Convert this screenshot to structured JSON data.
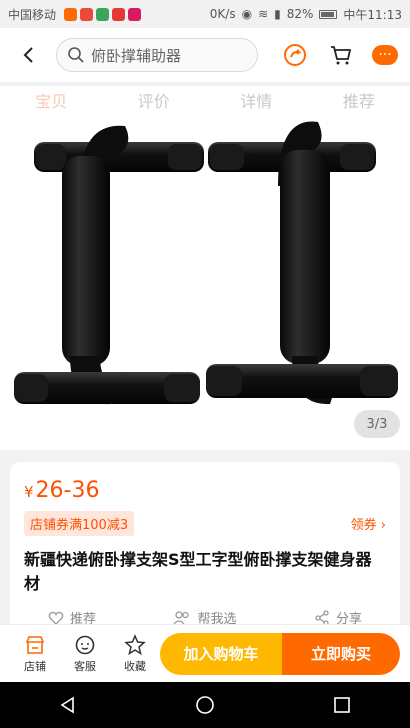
{
  "status_bar": {
    "carrier": "中国移动",
    "speed": "0K/s",
    "battery": "82%",
    "time": "中午11:13"
  },
  "header": {
    "search_placeholder": "俯卧撑辅助器",
    "more_label": "···"
  },
  "tabs": [
    {
      "label": "宝贝"
    },
    {
      "label": "评价"
    },
    {
      "label": "详情"
    },
    {
      "label": "推荐"
    }
  ],
  "gallery": {
    "page_indicator": "3/3"
  },
  "product": {
    "currency": "¥",
    "price": "26-36",
    "coupon": "店铺券满100减3",
    "coupon_link": "领券 ›",
    "title": "新疆快递俯卧撑支架S型工字型俯卧撑支架健身器材"
  },
  "actions": [
    {
      "label": "推荐",
      "icon": "heart-icon"
    },
    {
      "label": "帮我选",
      "icon": "people-icon"
    },
    {
      "label": "分享",
      "icon": "share-icon"
    }
  ],
  "bottom_bar": {
    "shop": "店铺",
    "service": "客服",
    "favorite": "收藏",
    "add_to_cart": "加入购物车",
    "buy_now": "立即购买"
  },
  "colors": {
    "accent": "#ff5000",
    "cart_button": "#ffb800",
    "buy_button": "#ff6a00"
  }
}
